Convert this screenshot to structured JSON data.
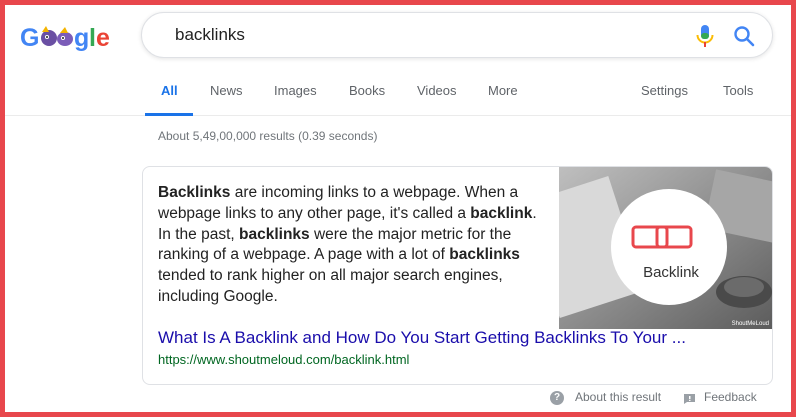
{
  "logo": {
    "text": "Google"
  },
  "search": {
    "query": "backlinks",
    "mic_icon": "mic-icon",
    "search_icon": "search-icon"
  },
  "tabs": [
    {
      "label": "All",
      "active": true
    },
    {
      "label": "News"
    },
    {
      "label": "Images"
    },
    {
      "label": "Books"
    },
    {
      "label": "Videos"
    },
    {
      "label": "More"
    },
    {
      "label": "Settings"
    },
    {
      "label": "Tools"
    }
  ],
  "results_stats": "About 5,49,00,000 results (0.39 seconds)",
  "featured_snippet": {
    "segments": [
      {
        "text": "Backlinks",
        "bold": true
      },
      {
        "text": " are incoming links to a webpage. When a webpage links to any other page, it's called a ",
        "bold": false
      },
      {
        "text": "backlink",
        "bold": true
      },
      {
        "text": ". In the past, ",
        "bold": false
      },
      {
        "text": "backlinks",
        "bold": true
      },
      {
        "text": " were the major metric for the ranking of a webpage. A page with a lot of ",
        "bold": false
      },
      {
        "text": "backlinks",
        "bold": true
      },
      {
        "text": " tended to rank higher on all major search engines, including Google.",
        "bold": false
      }
    ],
    "image": {
      "label": "Backlink",
      "credit": "ShoutMeLoud"
    },
    "title": "What Is A Backlink and How Do You Start Getting Backlinks To Your ...",
    "url": "https://www.shoutmeloud.com/backlink.html"
  },
  "footer": {
    "about": "About this result",
    "feedback": "Feedback"
  },
  "colors": {
    "frame": "#e8474c",
    "link": "#1a0dab",
    "url": "#006621",
    "accent": "#1a73e8"
  }
}
